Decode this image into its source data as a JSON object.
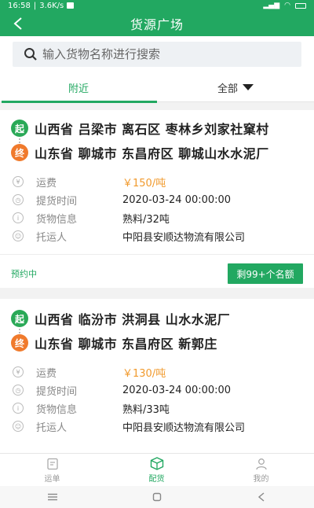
{
  "status_bar": {
    "time": "16:58",
    "speed": "3.6K/s"
  },
  "header": {
    "title": "货源广场"
  },
  "search": {
    "placeholder": "输入货物名称进行搜索"
  },
  "tabs": {
    "nearby": "附近",
    "all": "全部"
  },
  "cards": [
    {
      "start_badge": "起",
      "end_badge": "终",
      "origin": "山西省 吕梁市 离石区 枣林乡刘家社窠村",
      "destination": "山东省 聊城市 东昌府区 聊城山水水泥厂",
      "rows": [
        {
          "label": "运费",
          "value": "￥150/吨",
          "icon": "yen-icon"
        },
        {
          "label": "提货时间",
          "value": "2020-03-24 00:00:00",
          "icon": "clock-icon"
        },
        {
          "label": "货物信息",
          "value": "熟料/32吨",
          "icon": "info-icon"
        },
        {
          "label": "托运人",
          "value": "中阳县安顺达物流有限公司",
          "icon": "person-icon"
        }
      ],
      "status": "预约中",
      "quota": "剩99+个名额"
    },
    {
      "start_badge": "起",
      "end_badge": "终",
      "origin": "山西省 临汾市 洪洞县 山水水泥厂",
      "destination": "山东省 聊城市 东昌府区 新郭庄",
      "rows": [
        {
          "label": "运费",
          "value": "￥130/吨",
          "icon": "yen-icon"
        },
        {
          "label": "提货时间",
          "value": "2020-03-24 00:00:00",
          "icon": "clock-icon"
        },
        {
          "label": "货物信息",
          "value": "熟料/33吨",
          "icon": "info-icon"
        },
        {
          "label": "托运人",
          "value": "中阳县安顺达物流有限公司",
          "icon": "person-icon"
        }
      ]
    }
  ],
  "bottom_nav": [
    {
      "label": "运单",
      "icon": "document-icon"
    },
    {
      "label": "配货",
      "icon": "box-icon"
    },
    {
      "label": "我的",
      "icon": "user-icon"
    }
  ],
  "colors": {
    "accent": "#22a861",
    "price": "#f19a2d",
    "end_badge": "#f07a2c"
  }
}
